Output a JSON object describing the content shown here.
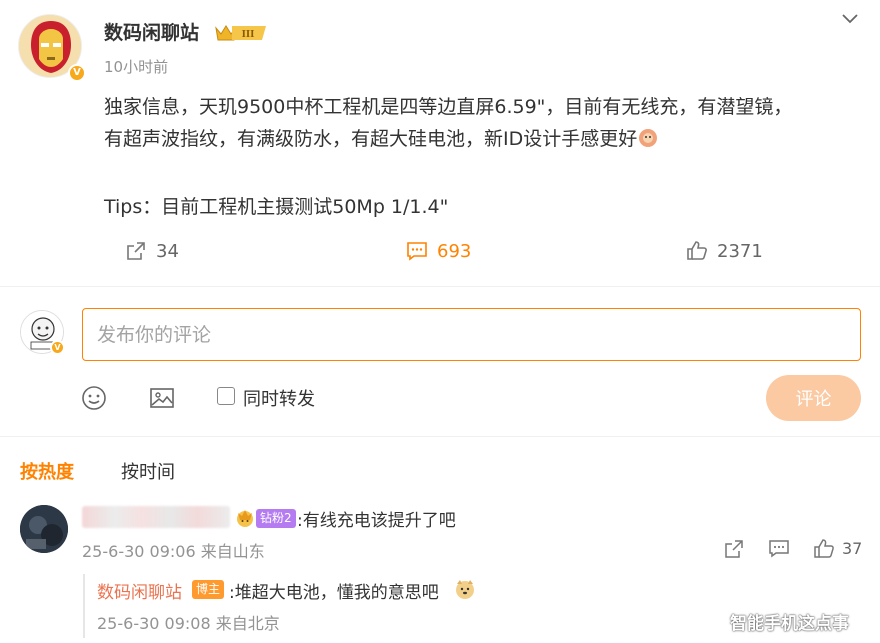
{
  "post": {
    "author": "数码闲聊站",
    "level_badge": "III",
    "time": "10小时前",
    "body_line1": "独家信息，天玑9500中杯工程机是四等边直屏6.59\"，目前有无线充，有潜望镜，",
    "body_line2": "有超声波指纹，有满级防水，有超大硅电池，新ID设计手感更好",
    "tips": "Tips：目前工程机主摄测试50Mp 1/1.4\"",
    "verified_mark": "V"
  },
  "actions": {
    "repost_count": "34",
    "comment_count": "693",
    "like_count": "2371"
  },
  "composer": {
    "placeholder": "发布你的评论",
    "repost_label": "同时转发",
    "submit_label": "评论"
  },
  "sort": {
    "hot": "按热度",
    "time": "按时间"
  },
  "comments": [
    {
      "fan_badge": "钻粉2",
      "text": ":有线充电该提升了吧",
      "meta": "25-6-30 09:06 来自山东",
      "like_count": "37",
      "replies": [
        {
          "author": "数码闲聊站",
          "badge": "博主",
          "text": ":堆超大电池，懂我的意思吧",
          "meta": "25-6-30 09:08 来自北京"
        }
      ]
    }
  ],
  "watermark": "智能手机这点事",
  "colors": {
    "accent": "#ff8200",
    "reply_author": "#eb7350",
    "submit_disabled": "#fbc9a2",
    "fan_badge": "#b47cf0",
    "host_badge": "#ff9a2e"
  }
}
